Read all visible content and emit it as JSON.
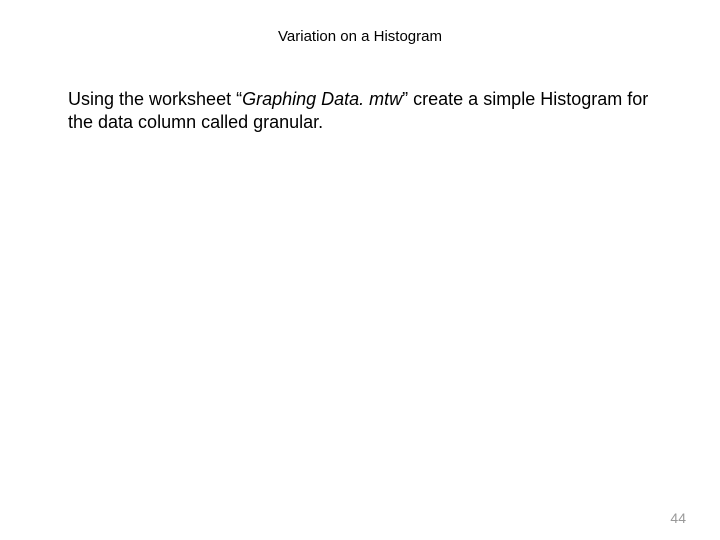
{
  "title": "Variation on a Histogram",
  "body": {
    "pre": "Using the worksheet “",
    "italic": "Graphing Data. mtw",
    "post": "” create a simple Histogram for the data column called granular."
  },
  "page_number": "44"
}
